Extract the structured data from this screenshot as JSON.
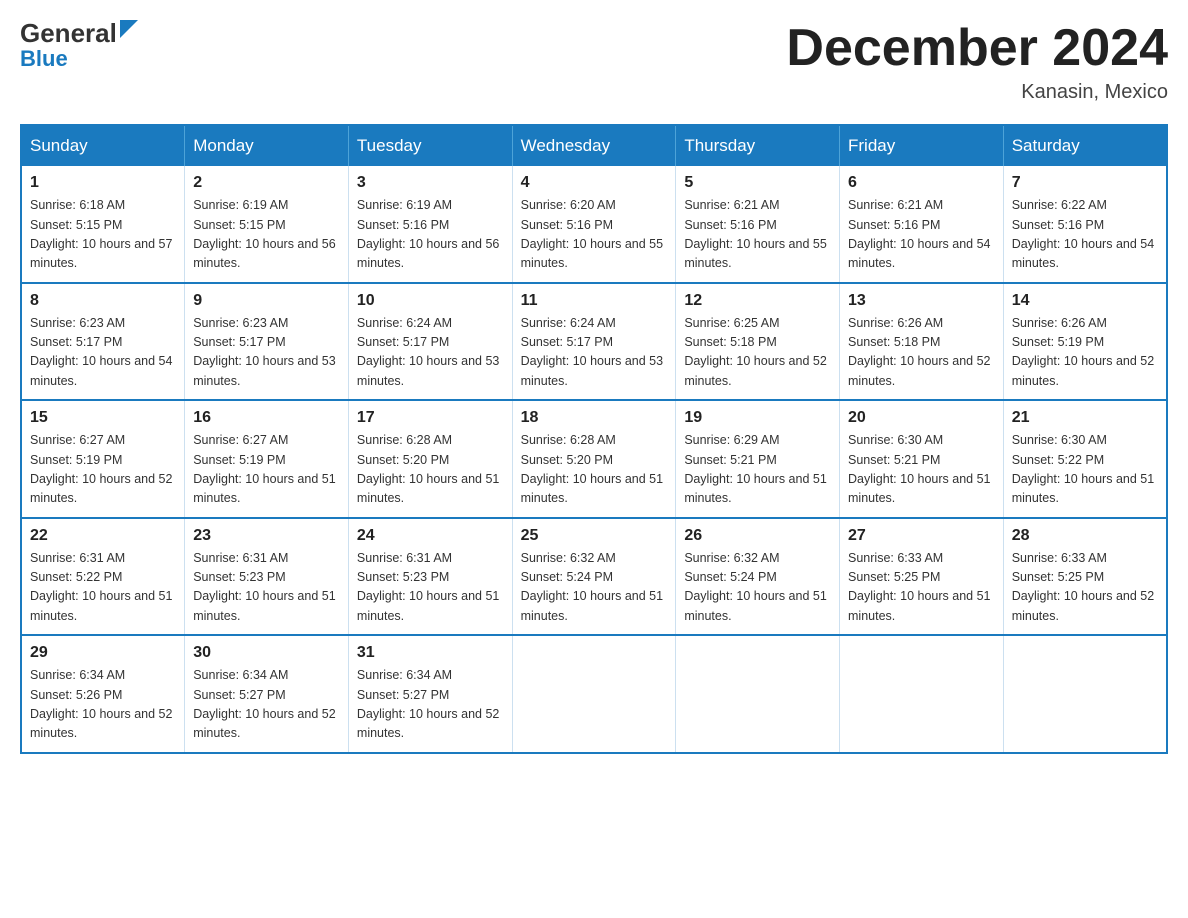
{
  "header": {
    "logo_line1": "General",
    "logo_line2": "Blue",
    "month_title": "December 2024",
    "location": "Kanasin, Mexico"
  },
  "calendar": {
    "days_of_week": [
      "Sunday",
      "Monday",
      "Tuesday",
      "Wednesday",
      "Thursday",
      "Friday",
      "Saturday"
    ],
    "weeks": [
      [
        {
          "day": "1",
          "sunrise": "6:18 AM",
          "sunset": "5:15 PM",
          "daylight": "10 hours and 57 minutes."
        },
        {
          "day": "2",
          "sunrise": "6:19 AM",
          "sunset": "5:15 PM",
          "daylight": "10 hours and 56 minutes."
        },
        {
          "day": "3",
          "sunrise": "6:19 AM",
          "sunset": "5:16 PM",
          "daylight": "10 hours and 56 minutes."
        },
        {
          "day": "4",
          "sunrise": "6:20 AM",
          "sunset": "5:16 PM",
          "daylight": "10 hours and 55 minutes."
        },
        {
          "day": "5",
          "sunrise": "6:21 AM",
          "sunset": "5:16 PM",
          "daylight": "10 hours and 55 minutes."
        },
        {
          "day": "6",
          "sunrise": "6:21 AM",
          "sunset": "5:16 PM",
          "daylight": "10 hours and 54 minutes."
        },
        {
          "day": "7",
          "sunrise": "6:22 AM",
          "sunset": "5:16 PM",
          "daylight": "10 hours and 54 minutes."
        }
      ],
      [
        {
          "day": "8",
          "sunrise": "6:23 AM",
          "sunset": "5:17 PM",
          "daylight": "10 hours and 54 minutes."
        },
        {
          "day": "9",
          "sunrise": "6:23 AM",
          "sunset": "5:17 PM",
          "daylight": "10 hours and 53 minutes."
        },
        {
          "day": "10",
          "sunrise": "6:24 AM",
          "sunset": "5:17 PM",
          "daylight": "10 hours and 53 minutes."
        },
        {
          "day": "11",
          "sunrise": "6:24 AM",
          "sunset": "5:17 PM",
          "daylight": "10 hours and 53 minutes."
        },
        {
          "day": "12",
          "sunrise": "6:25 AM",
          "sunset": "5:18 PM",
          "daylight": "10 hours and 52 minutes."
        },
        {
          "day": "13",
          "sunrise": "6:26 AM",
          "sunset": "5:18 PM",
          "daylight": "10 hours and 52 minutes."
        },
        {
          "day": "14",
          "sunrise": "6:26 AM",
          "sunset": "5:19 PM",
          "daylight": "10 hours and 52 minutes."
        }
      ],
      [
        {
          "day": "15",
          "sunrise": "6:27 AM",
          "sunset": "5:19 PM",
          "daylight": "10 hours and 52 minutes."
        },
        {
          "day": "16",
          "sunrise": "6:27 AM",
          "sunset": "5:19 PM",
          "daylight": "10 hours and 51 minutes."
        },
        {
          "day": "17",
          "sunrise": "6:28 AM",
          "sunset": "5:20 PM",
          "daylight": "10 hours and 51 minutes."
        },
        {
          "day": "18",
          "sunrise": "6:28 AM",
          "sunset": "5:20 PM",
          "daylight": "10 hours and 51 minutes."
        },
        {
          "day": "19",
          "sunrise": "6:29 AM",
          "sunset": "5:21 PM",
          "daylight": "10 hours and 51 minutes."
        },
        {
          "day": "20",
          "sunrise": "6:30 AM",
          "sunset": "5:21 PM",
          "daylight": "10 hours and 51 minutes."
        },
        {
          "day": "21",
          "sunrise": "6:30 AM",
          "sunset": "5:22 PM",
          "daylight": "10 hours and 51 minutes."
        }
      ],
      [
        {
          "day": "22",
          "sunrise": "6:31 AM",
          "sunset": "5:22 PM",
          "daylight": "10 hours and 51 minutes."
        },
        {
          "day": "23",
          "sunrise": "6:31 AM",
          "sunset": "5:23 PM",
          "daylight": "10 hours and 51 minutes."
        },
        {
          "day": "24",
          "sunrise": "6:31 AM",
          "sunset": "5:23 PM",
          "daylight": "10 hours and 51 minutes."
        },
        {
          "day": "25",
          "sunrise": "6:32 AM",
          "sunset": "5:24 PM",
          "daylight": "10 hours and 51 minutes."
        },
        {
          "day": "26",
          "sunrise": "6:32 AM",
          "sunset": "5:24 PM",
          "daylight": "10 hours and 51 minutes."
        },
        {
          "day": "27",
          "sunrise": "6:33 AM",
          "sunset": "5:25 PM",
          "daylight": "10 hours and 51 minutes."
        },
        {
          "day": "28",
          "sunrise": "6:33 AM",
          "sunset": "5:25 PM",
          "daylight": "10 hours and 52 minutes."
        }
      ],
      [
        {
          "day": "29",
          "sunrise": "6:34 AM",
          "sunset": "5:26 PM",
          "daylight": "10 hours and 52 minutes."
        },
        {
          "day": "30",
          "sunrise": "6:34 AM",
          "sunset": "5:27 PM",
          "daylight": "10 hours and 52 minutes."
        },
        {
          "day": "31",
          "sunrise": "6:34 AM",
          "sunset": "5:27 PM",
          "daylight": "10 hours and 52 minutes."
        },
        null,
        null,
        null,
        null
      ]
    ]
  }
}
